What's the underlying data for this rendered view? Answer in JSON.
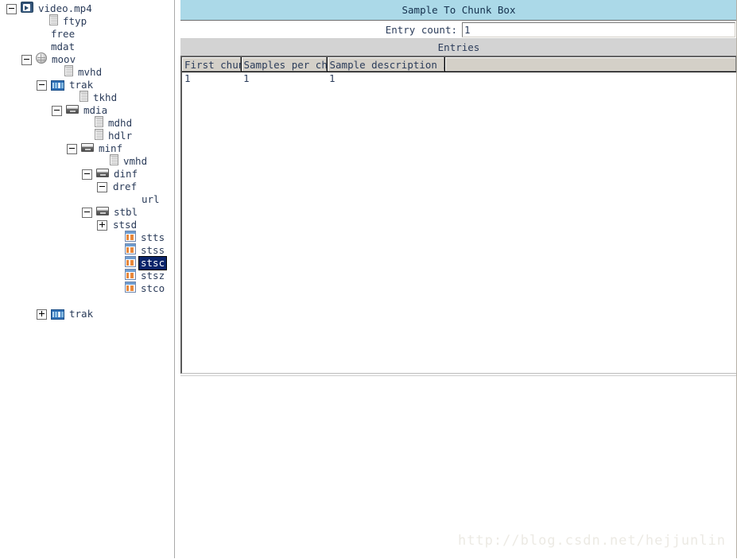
{
  "tree": {
    "name": "mp4-atom-tree",
    "items": [
      {
        "label": "video.mp4",
        "depth": 0,
        "toggle": "minus",
        "icon": "movie-icon"
      },
      {
        "label": "ftyp",
        "depth": 2,
        "toggle": "none",
        "icon": "document-icon"
      },
      {
        "label": "free",
        "depth": 2,
        "toggle": "none",
        "icon": "none"
      },
      {
        "label": "mdat",
        "depth": 2,
        "toggle": "none",
        "icon": "none"
      },
      {
        "label": "moov",
        "depth": 1,
        "toggle": "minus",
        "icon": "globe-icon"
      },
      {
        "label": "mvhd",
        "depth": 3,
        "toggle": "none",
        "icon": "document-icon"
      },
      {
        "label": "trak",
        "depth": 2,
        "toggle": "minus",
        "icon": "film-icon"
      },
      {
        "label": "tkhd",
        "depth": 4,
        "toggle": "none",
        "icon": "document-icon"
      },
      {
        "label": "mdia",
        "depth": 3,
        "toggle": "minus",
        "icon": "drawer-icon"
      },
      {
        "label": "mdhd",
        "depth": 5,
        "toggle": "none",
        "icon": "document-icon"
      },
      {
        "label": "hdlr",
        "depth": 5,
        "toggle": "none",
        "icon": "document-icon"
      },
      {
        "label": "minf",
        "depth": 4,
        "toggle": "minus",
        "icon": "drawer-icon"
      },
      {
        "label": "vmhd",
        "depth": 6,
        "toggle": "none",
        "icon": "document-icon"
      },
      {
        "label": "dinf",
        "depth": 5,
        "toggle": "minus",
        "icon": "drawer-icon"
      },
      {
        "label": "dref",
        "depth": 6,
        "toggle": "minus",
        "icon": "none"
      },
      {
        "label": "url",
        "depth": 8,
        "toggle": "none",
        "icon": "none"
      },
      {
        "label": "stbl",
        "depth": 5,
        "toggle": "minus",
        "icon": "drawer-icon"
      },
      {
        "label": "stsd",
        "depth": 6,
        "toggle": "plus",
        "icon": "none"
      },
      {
        "label": "stts",
        "depth": 7,
        "toggle": "none",
        "icon": "table-icon"
      },
      {
        "label": "stss",
        "depth": 7,
        "toggle": "none",
        "icon": "table-icon"
      },
      {
        "label": "stsc",
        "depth": 7,
        "toggle": "none",
        "icon": "table-icon",
        "selected": true
      },
      {
        "label": "stsz",
        "depth": 7,
        "toggle": "none",
        "icon": "table-icon"
      },
      {
        "label": "stco",
        "depth": 7,
        "toggle": "none",
        "icon": "table-icon"
      },
      {
        "label": "trak",
        "depth": 2,
        "toggle": "plus",
        "icon": "film-icon",
        "gap_before": 16
      }
    ]
  },
  "detail": {
    "title": "Sample To Chunk Box",
    "entry_count": {
      "label": "Entry count:",
      "value": "1",
      "placeholder": ""
    },
    "entries_section_label": "Entries",
    "table": {
      "columns": [
        "First chunk",
        "Samples per chunk",
        "Sample description index",
        ""
      ],
      "rows": [
        [
          "1",
          "1",
          "1",
          ""
        ]
      ]
    }
  },
  "watermark": "http://blog.csdn.net/hejjunlin",
  "colors": {
    "title_bar": "#abd9e8",
    "entries_bar": "#d3d3d3",
    "table_header": "#d4d0c8",
    "selection": "#0a246a",
    "text": "#2b3c5a",
    "watermark": "#eceae4"
  }
}
